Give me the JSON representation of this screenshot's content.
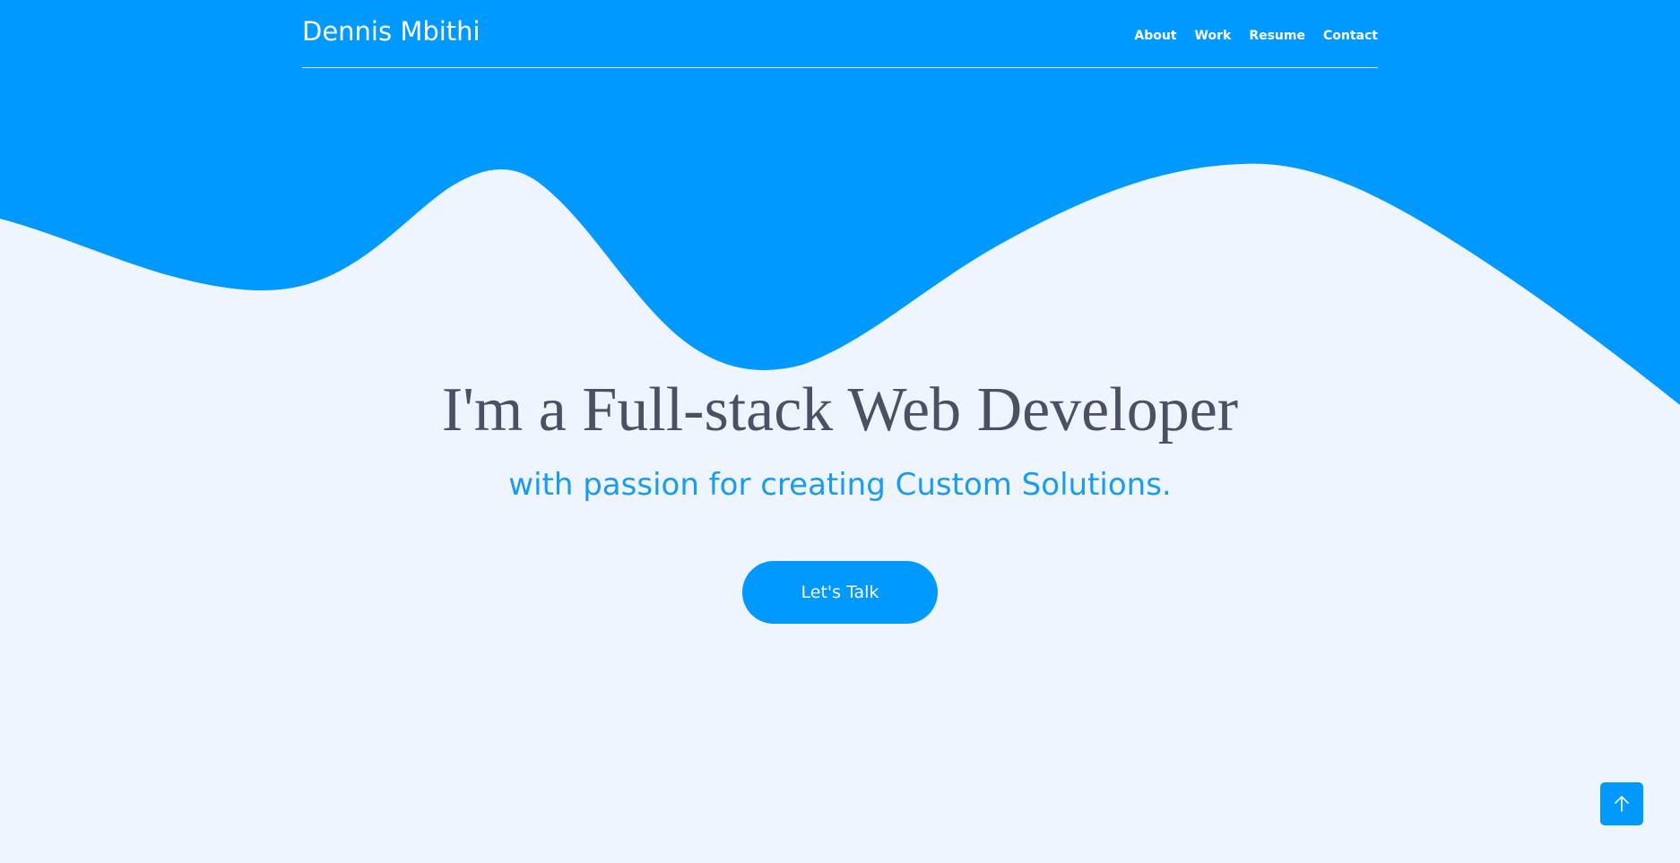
{
  "nav": {
    "brand": "Dennis Mbithi",
    "links": [
      "About",
      "Work",
      "Resume",
      "Contact"
    ]
  },
  "hero": {
    "title": "I'm a Full-stack Web Developer",
    "subtitle": "with passion for creating Custom Solutions.",
    "cta_label": "Let's Talk"
  },
  "icons": {
    "scroll_top": "arrow-up-icon"
  },
  "colors": {
    "primary": "#0099FF",
    "background": "#EEF5FE",
    "title_text": "#4A5162",
    "subtitle_text": "#1A9BF2"
  }
}
